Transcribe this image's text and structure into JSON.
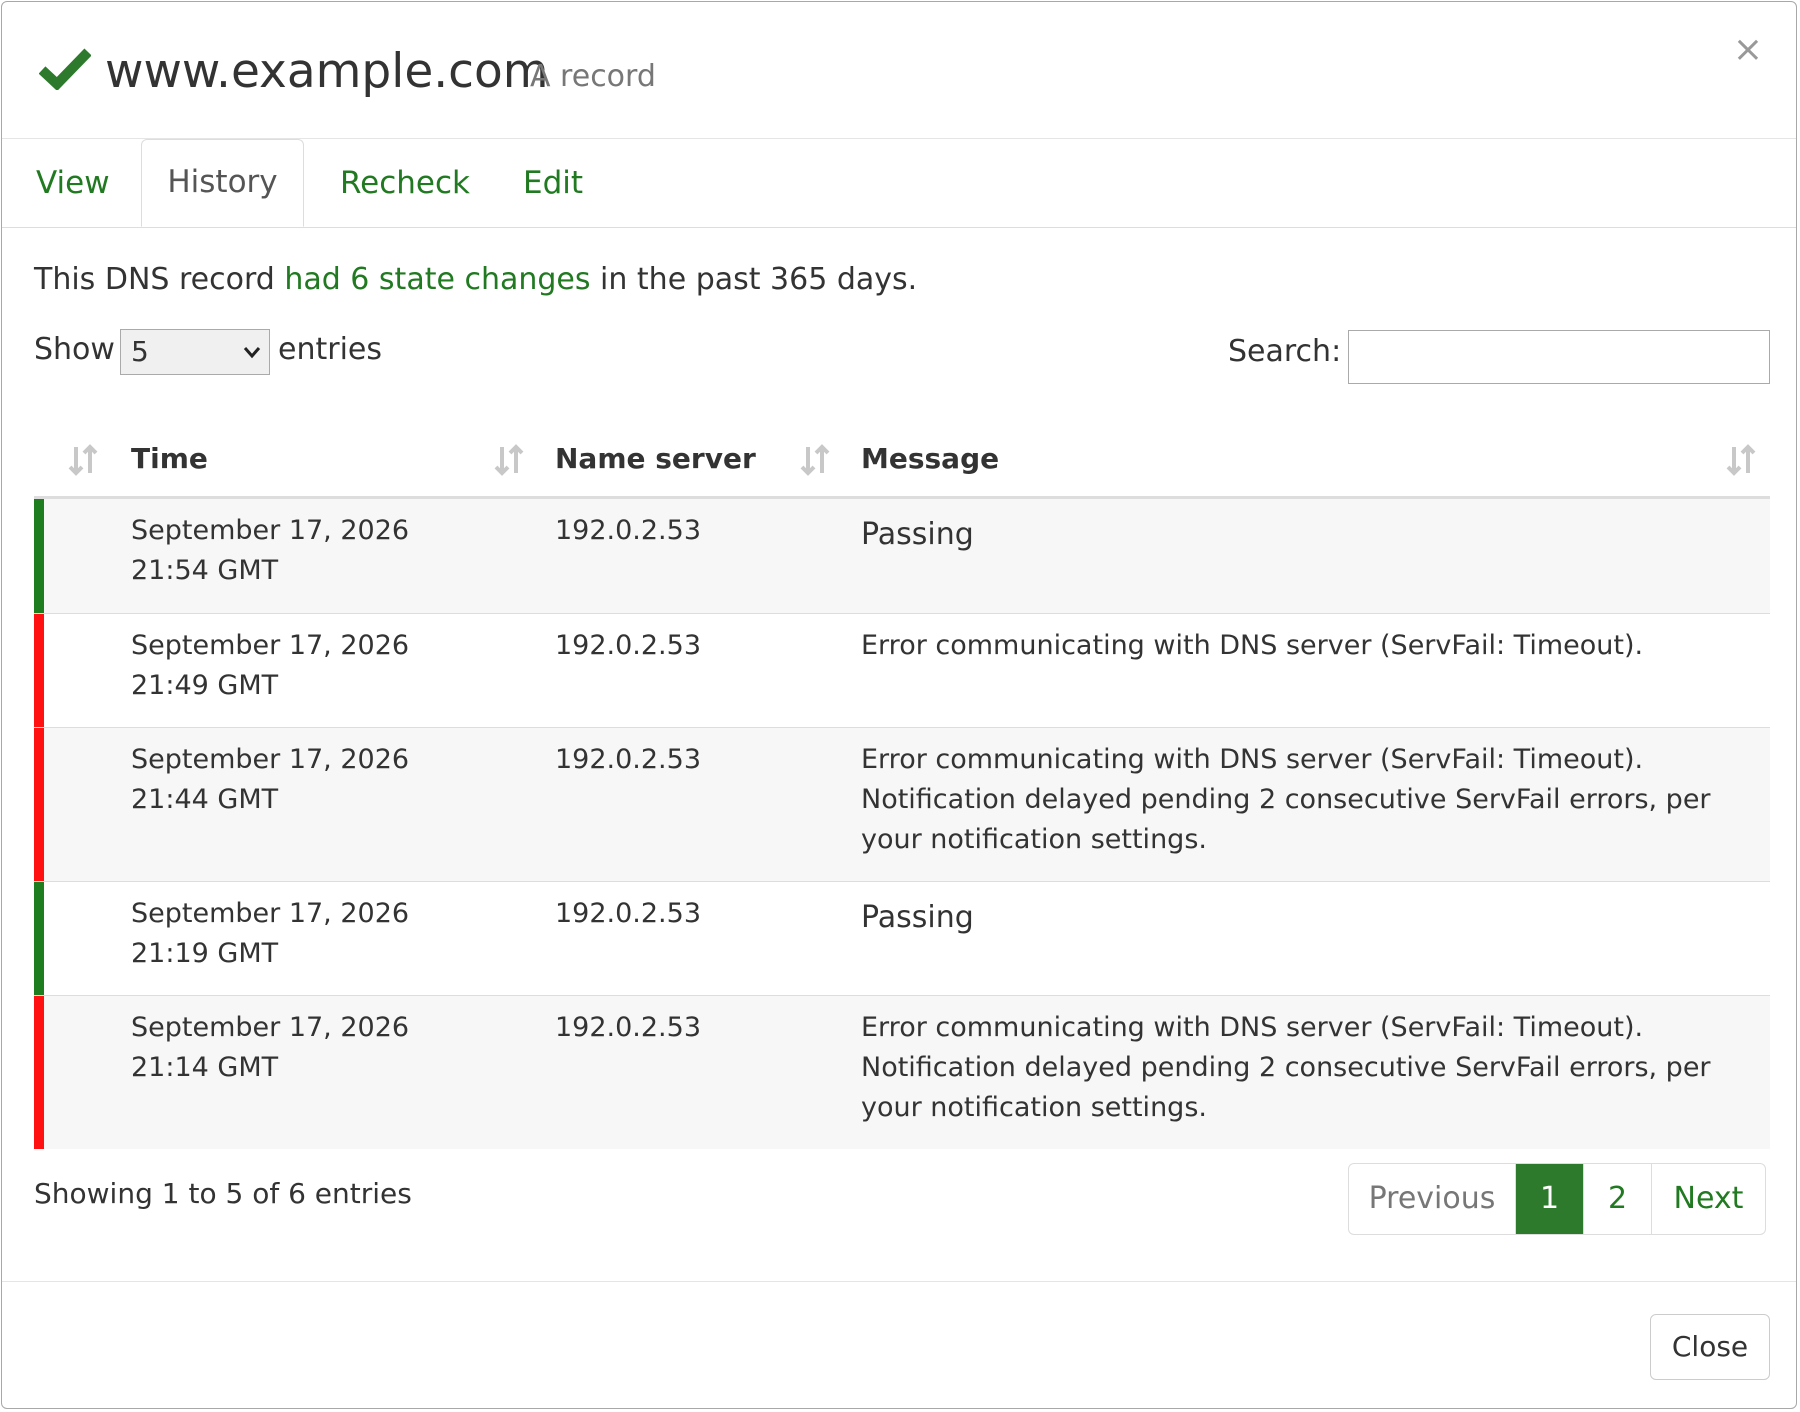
{
  "header": {
    "hostname": "www.example.com",
    "record_type": "A record",
    "close_symbol": "×",
    "status_icon": "check-icon",
    "status_color": "#2d7a2d"
  },
  "tabs": [
    {
      "label": "View",
      "active": false
    },
    {
      "label": "History",
      "active": true
    },
    {
      "label": "Recheck",
      "active": false
    },
    {
      "label": "Edit",
      "active": false
    }
  ],
  "summary": {
    "prefix": "This DNS record ",
    "link": "had 6 state changes",
    "suffix": " in the past 365 days."
  },
  "controls": {
    "show_label": "Show",
    "page_length": "5",
    "entries_label": "entries",
    "search_label": "Search:",
    "search_value": ""
  },
  "table": {
    "columns": [
      "Time",
      "Name server",
      "Message"
    ],
    "rows": [
      {
        "status": "passing",
        "time": "September 17, 2026 21:54 GMT",
        "name_server": "192.0.2.53",
        "message": "Passing"
      },
      {
        "status": "failing",
        "time": "September 17, 2026 21:49 GMT",
        "name_server": "192.0.2.53",
        "message": "Error communicating with DNS server (ServFail: Timeout)."
      },
      {
        "status": "failing",
        "time": "September 17, 2026 21:44 GMT",
        "name_server": "192.0.2.53",
        "message": "Error communicating with DNS server (ServFail: Timeout). Notification delayed pending 2 consecutive ServFail errors, per your notification settings."
      },
      {
        "status": "passing",
        "time": "September 17, 2026 21:19 GMT",
        "name_server": "192.0.2.53",
        "message": "Passing"
      },
      {
        "status": "failing",
        "time": "September 17, 2026 21:14 GMT",
        "name_server": "192.0.2.53",
        "message": "Error communicating with DNS server (ServFail: Timeout). Notification delayed pending 2 consecutive ServFail errors, per your notification settings."
      }
    ]
  },
  "info": "Showing 1 to 5 of 6 entries",
  "pagination": {
    "previous": "Previous",
    "pages": [
      "1",
      "2"
    ],
    "current": "1",
    "next": "Next"
  },
  "footer": {
    "close_label": "Close"
  },
  "colors": {
    "accent": "#217a21",
    "passing": "#1e7d1e",
    "failing": "#ff1111"
  }
}
